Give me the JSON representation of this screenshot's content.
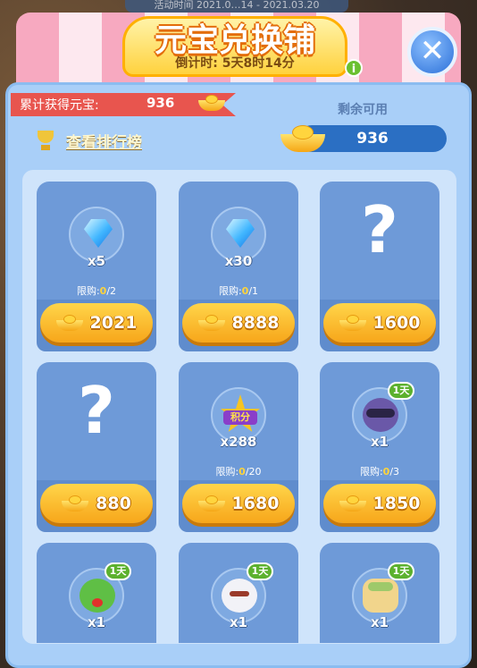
{
  "header": {
    "event_strip_text": "活动时间 2021.0…14 - 2021.03.20",
    "title": "元宝兑换铺",
    "countdown": "倒计时: 5天8时14分",
    "info_glyph": "i",
    "close_glyph": "✕"
  },
  "summary": {
    "earned_label": "累计获得元宝:",
    "earned_value": "936",
    "rank_link": "查看排行榜",
    "remaining_label": "剩余可用",
    "remaining_value": "936"
  },
  "colors": {
    "panel": "#a9cff8",
    "card": "#6e9ad8",
    "button_gold": "#f7a61a",
    "ribbon_red": "#e8554e",
    "badge_green": "#5cb12e"
  },
  "items": [
    {
      "icon": "diamond-icon",
      "qty": "x5",
      "limit_prefix": "限购:",
      "limit_used": "0",
      "limit_total": "/2",
      "price": "2021"
    },
    {
      "icon": "diamond-icon",
      "qty": "x30",
      "limit_prefix": "限购:",
      "limit_used": "0",
      "limit_total": "/1",
      "price": "8888"
    },
    {
      "icon": "mystery-icon",
      "mystery": "?",
      "price": "1600"
    },
    {
      "icon": "mystery-icon",
      "mystery": "?",
      "price": "880"
    },
    {
      "icon": "points-star-icon",
      "star_text": "积分",
      "qty": "x288",
      "limit_prefix": "限购:",
      "limit_used": "0",
      "limit_total": "/20",
      "price": "1680"
    },
    {
      "icon": "cat-avatar-icon",
      "duration": "1天",
      "qty": "x1",
      "limit_prefix": "限购:",
      "limit_used": "0",
      "limit_total": "/3",
      "price": "1850"
    },
    {
      "icon": "frog-avatar-icon",
      "duration": "1天",
      "qty": "x1"
    },
    {
      "icon": "bunny-avatar-icon",
      "duration": "1天",
      "qty": "x1"
    },
    {
      "icon": "cake-avatar-icon",
      "duration": "1天",
      "qty": "x1"
    }
  ]
}
